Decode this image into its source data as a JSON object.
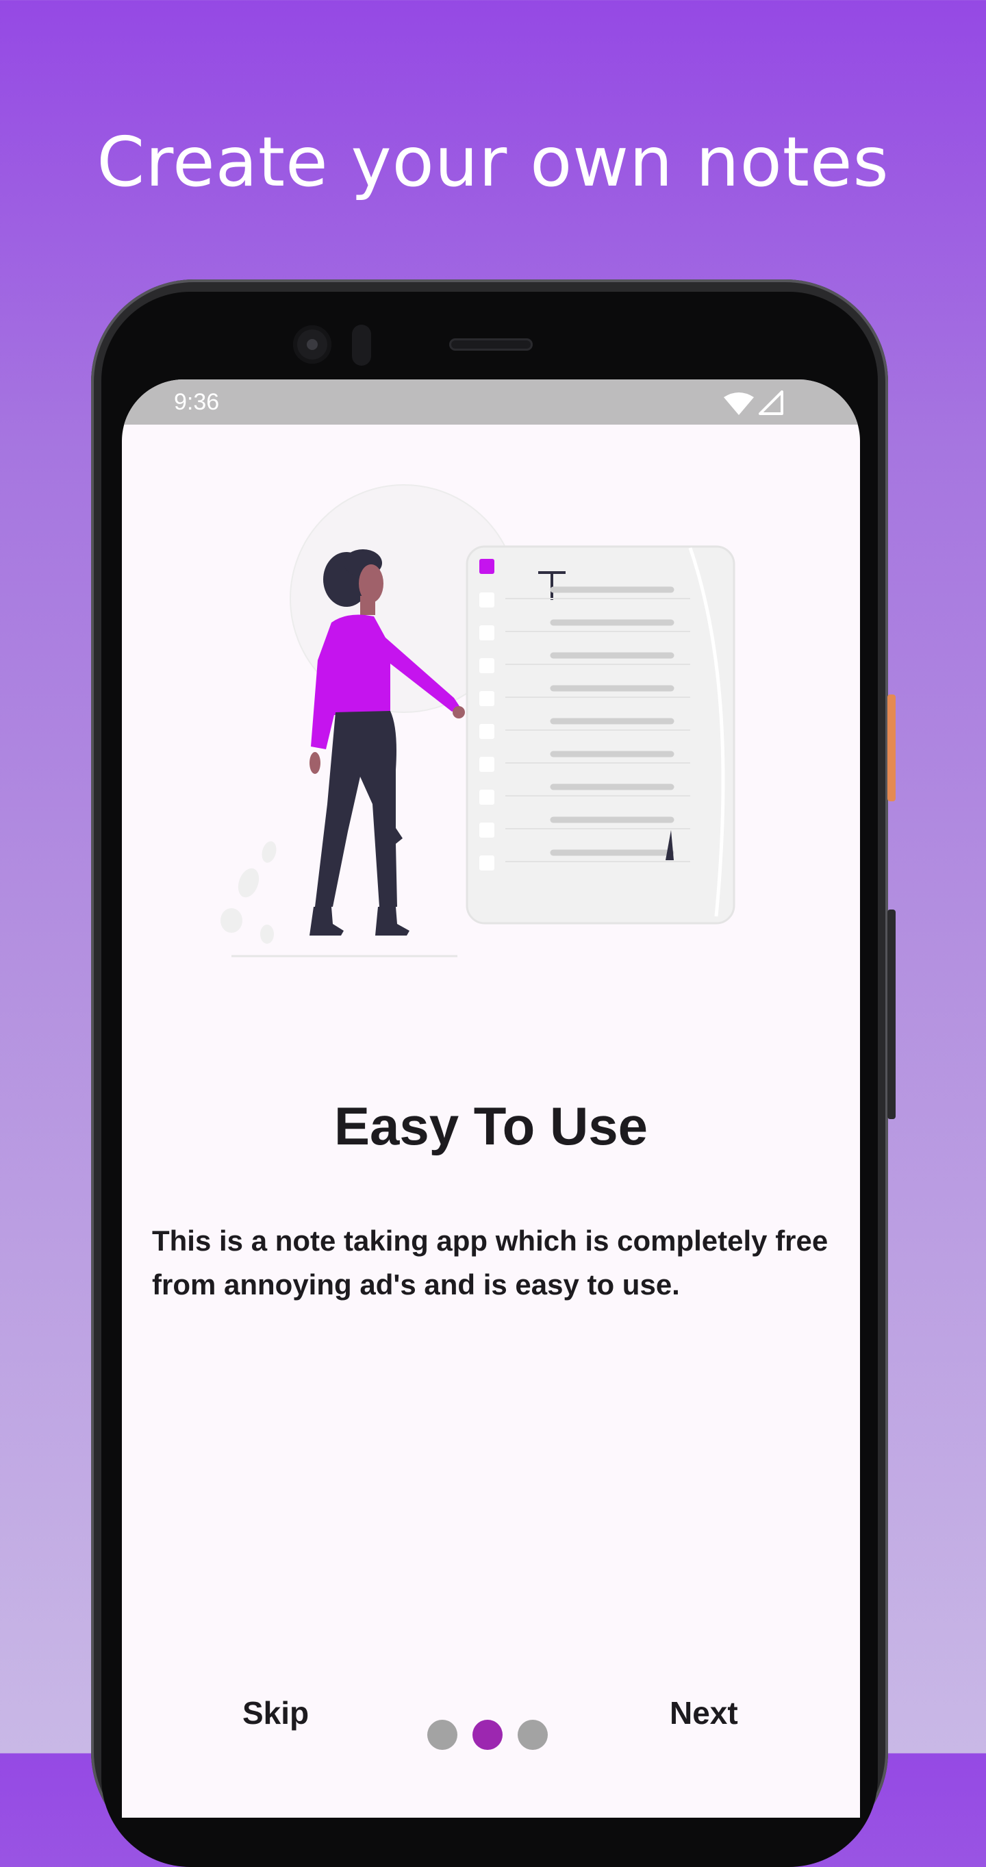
{
  "onboarding": {
    "headline": "Create your own notes",
    "title": "Easy To Use",
    "description": "This is a note taking app which is completely free from annoying ad's and is easy to use.",
    "skip_label": "Skip",
    "next_label": "Next",
    "page_indicator": {
      "count": 3,
      "active_index": 1
    }
  },
  "status_bar": {
    "time": "9:36"
  },
  "colors": {
    "accent": "#9c27b0",
    "illustration_accent": "#c514ee",
    "background_top": "#9549e4",
    "background_bottom": "#c9b8e6",
    "screen_bg": "#fdf8fd"
  }
}
